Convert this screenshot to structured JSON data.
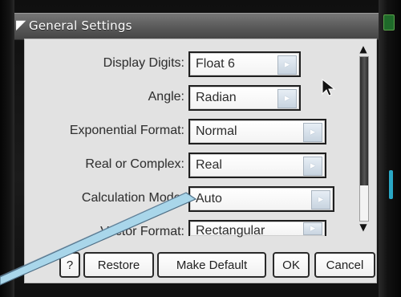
{
  "window": {
    "title": "General Settings",
    "title_icon": "corner-icon"
  },
  "settings": [
    {
      "label": "Display Digits:",
      "value": "Float 6"
    },
    {
      "label": "Angle:",
      "value": "Radian"
    },
    {
      "label": "Exponential Format:",
      "value": "Normal"
    },
    {
      "label": "Real or Complex:",
      "value": "Real"
    },
    {
      "label": "Calculation Mode:",
      "value": "Auto"
    },
    {
      "label": "Vector Format:",
      "value": "Rectangular"
    }
  ],
  "buttons": {
    "help": "?",
    "restore": "Restore",
    "make_default": "Make Default",
    "ok": "OK",
    "cancel": "Cancel"
  },
  "scroll": {
    "up_icon": "chevron-up-icon",
    "down_icon": "chevron-down-icon"
  },
  "icons": {
    "cursor": "mouse-pointer-icon",
    "callout": "callout-pointer-icon",
    "dropdown": "chevron-right-icon"
  },
  "colors": {
    "panel_bg": "#e2e2e2",
    "title_bar": "#5b5b5b",
    "callout": "#a9d6ea",
    "accent_teal": "#2aa7c5"
  }
}
